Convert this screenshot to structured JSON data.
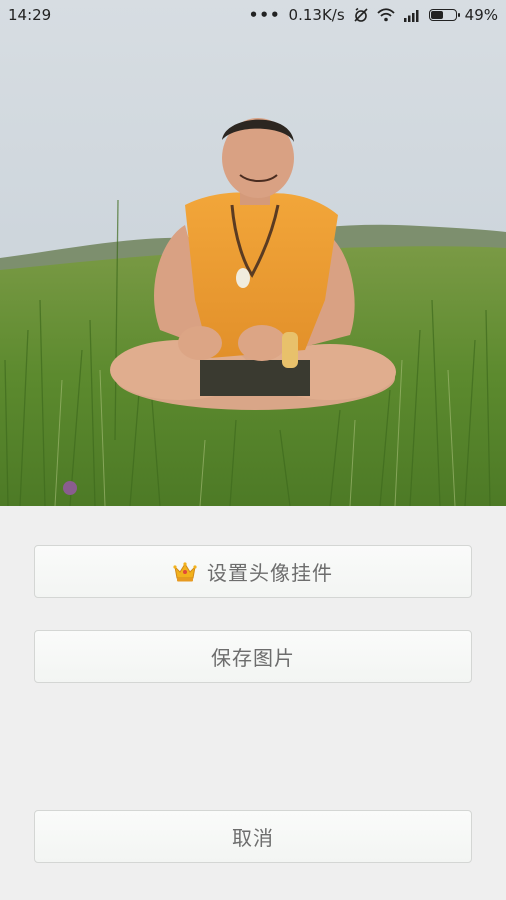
{
  "status_bar": {
    "time": "14:29",
    "more": "•••",
    "network_speed": "0.13K/s",
    "battery_percent": "49%",
    "battery_level": 0.49,
    "icons": [
      "dots-icon",
      "no-alarm-icon",
      "wifi-icon",
      "signal-icon",
      "battery-icon"
    ]
  },
  "photo": {
    "subject": "man in orange vest sitting cross-legged in grassland"
  },
  "actions": {
    "set_avatar_widget": "设置头像挂件",
    "save_image": "保存图片",
    "cancel": "取消"
  },
  "colors": {
    "background": "#efefef",
    "button_text": "#6d6d6d",
    "crown": "#f2b21c"
  }
}
